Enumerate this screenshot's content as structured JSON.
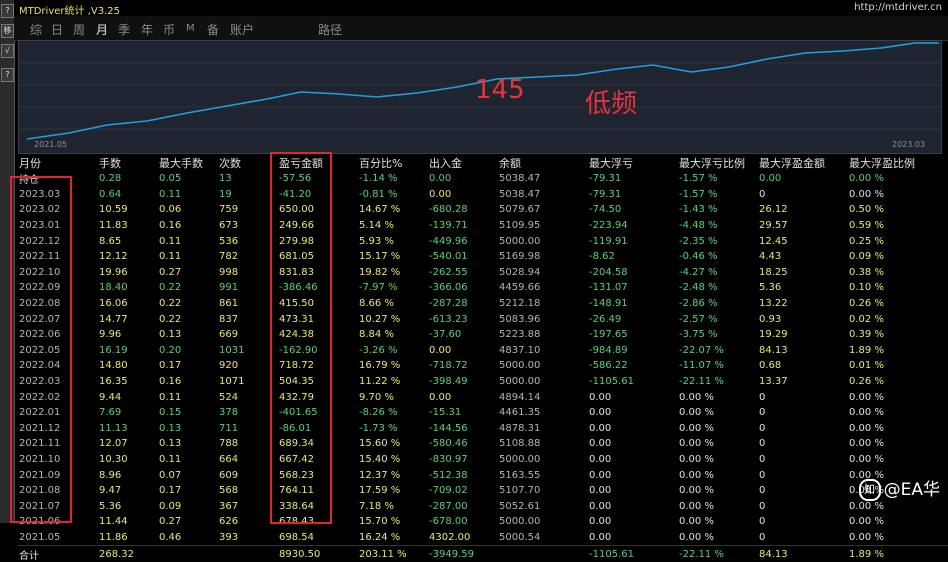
{
  "window": {
    "title": "MTDriver统计 ,V3.25",
    "url": "http://mtdriver.cn"
  },
  "left_buttons": [
    "?",
    "移",
    "√",
    "?"
  ],
  "tabs": [
    {
      "label": "综",
      "active": false
    },
    {
      "label": "日",
      "active": false
    },
    {
      "label": "周",
      "active": false
    },
    {
      "label": "月",
      "active": true
    },
    {
      "label": "季",
      "active": false
    },
    {
      "label": "年",
      "active": false
    },
    {
      "label": "币",
      "active": false
    },
    {
      "label": "M",
      "active": false
    },
    {
      "label": "备",
      "active": false
    },
    {
      "label": "账户",
      "active": false
    },
    {
      "label": "路径",
      "active": false
    }
  ],
  "chart": {
    "start_date": "2021.05",
    "end_date": "2023.03",
    "line_color": "#1f9fe0",
    "overlay_number": "145",
    "overlay_text": "低频"
  },
  "table": {
    "headers": [
      "月份",
      "手数",
      "最大手数",
      "次数",
      "盈亏金额",
      "百分比%",
      "出入金",
      "余额",
      "最大浮亏",
      "最大浮亏比例",
      "最大浮盈金额",
      "最大浮盈比例"
    ],
    "rows": [
      [
        "持仓",
        "0.28",
        "0.05",
        "13",
        "-57.56",
        "-1.14 %",
        "0.00",
        "5038.47",
        "-79.31",
        "-1.57 %",
        "0.00",
        "0.00 %"
      ],
      [
        "2023.03",
        "0.64",
        "0.11",
        "19",
        "-41.20",
        "-0.81 %",
        "0.00",
        "5038.47",
        "-79.31",
        "-1.57 %",
        "0",
        "0.00 %"
      ],
      [
        "2023.02",
        "10.59",
        "0.06",
        "759",
        "650.00",
        "14.67 %",
        "-680.28",
        "5079.67",
        "-74.50",
        "-1.43 %",
        "26.12",
        "0.50 %"
      ],
      [
        "2023.01",
        "11.83",
        "0.16",
        "673",
        "249.66",
        "5.14 %",
        "-139.71",
        "5109.95",
        "-223.94",
        "-4.48 %",
        "29.57",
        "0.59 %"
      ],
      [
        "2022.12",
        "8.65",
        "0.11",
        "536",
        "279.98",
        "5.93 %",
        "-449.96",
        "5000.00",
        "-119.91",
        "-2.35 %",
        "12.45",
        "0.25 %"
      ],
      [
        "2022.11",
        "12.12",
        "0.11",
        "782",
        "681.05",
        "15.17 %",
        "-540.01",
        "5169.98",
        "-8.62",
        "-0.46 %",
        "4.43",
        "0.09 %"
      ],
      [
        "2022.10",
        "19.96",
        "0.27",
        "998",
        "831.83",
        "19.82 %",
        "-262.55",
        "5028.94",
        "-204.58",
        "-4.27 %",
        "18.25",
        "0.38 %"
      ],
      [
        "2022.09",
        "18.40",
        "0.22",
        "991",
        "-386.46",
        "-7.97 %",
        "-366.06",
        "4459.66",
        "-131.07",
        "-2.48 %",
        "5.36",
        "0.10 %"
      ],
      [
        "2022.08",
        "16.06",
        "0.22",
        "861",
        "415.50",
        "8.66 %",
        "-287.28",
        "5212.18",
        "-148.91",
        "-2.86 %",
        "13.22",
        "0.26 %"
      ],
      [
        "2022.07",
        "14.77",
        "0.22",
        "837",
        "473.31",
        "10.27 %",
        "-613.23",
        "5083.96",
        "-26.49",
        "-2.57 %",
        "0.93",
        "0.02 %"
      ],
      [
        "2022.06",
        "9.96",
        "0.13",
        "669",
        "424.38",
        "8.84 %",
        "-37.60",
        "5223.88",
        "-197.65",
        "-3.75 %",
        "19.29",
        "0.39 %"
      ],
      [
        "2022.05",
        "16.19",
        "0.20",
        "1031",
        "-162.90",
        "-3.26 %",
        "0.00",
        "4837.10",
        "-984.89",
        "-22.07 %",
        "84.13",
        "1.89 %"
      ],
      [
        "2022.04",
        "14.80",
        "0.17",
        "920",
        "718.72",
        "16.79 %",
        "-718.72",
        "5000.00",
        "-586.22",
        "-11.07 %",
        "0.68",
        "0.01 %"
      ],
      [
        "2022.03",
        "16.35",
        "0.16",
        "1071",
        "504.35",
        "11.22 %",
        "-398.49",
        "5000.00",
        "-1105.61",
        "-22.11 %",
        "13.37",
        "0.26 %"
      ],
      [
        "2022.02",
        "9.44",
        "0.11",
        "524",
        "432.79",
        "9.70 %",
        "0.00",
        "4894.14",
        "0.00",
        "0.00 %",
        "0",
        "0.00 %"
      ],
      [
        "2022.01",
        "7.69",
        "0.15",
        "378",
        "-401.65",
        "-8.26 %",
        "-15.31",
        "4461.35",
        "0.00",
        "0.00 %",
        "0",
        "0.00 %"
      ],
      [
        "2021.12",
        "11.13",
        "0.13",
        "711",
        "-86.01",
        "-1.73 %",
        "-144.56",
        "4878.31",
        "0.00",
        "0.00 %",
        "0",
        "0.00 %"
      ],
      [
        "2021.11",
        "12.07",
        "0.13",
        "788",
        "689.34",
        "15.60 %",
        "-580.46",
        "5108.88",
        "0.00",
        "0.00 %",
        "0",
        "0.00 %"
      ],
      [
        "2021.10",
        "10.30",
        "0.11",
        "664",
        "667.42",
        "15.40 %",
        "-830.97",
        "5000.00",
        "0.00",
        "0.00 %",
        "0",
        "0.00 %"
      ],
      [
        "2021.09",
        "8.96",
        "0.07",
        "609",
        "568.23",
        "12.37 %",
        "-512.38",
        "5163.55",
        "0.00",
        "0.00 %",
        "0",
        "0.00 %"
      ],
      [
        "2021.08",
        "9.47",
        "0.17",
        "568",
        "764.11",
        "17.59 %",
        "-709.02",
        "5107.70",
        "0.00",
        "0.00 %",
        "0",
        "0.00 %"
      ],
      [
        "2021.07",
        "5.36",
        "0.09",
        "367",
        "338.64",
        "7.18 %",
        "-287.00",
        "5052.61",
        "0.00",
        "0.00 %",
        "0",
        "0.00 %"
      ],
      [
        "2021.06",
        "11.44",
        "0.27",
        "626",
        "678.43",
        "15.70 %",
        "-678.00",
        "5000.00",
        "0.00",
        "0.00 %",
        "0",
        "0.00 %"
      ],
      [
        "2021.05",
        "11.86",
        "0.46",
        "393",
        "698.54",
        "16.24 %",
        "4302.00",
        "5000.54",
        "0.00",
        "0.00 %",
        "0",
        "0.00 %"
      ]
    ],
    "total": [
      "合计",
      "268.32",
      "",
      "",
      "8930.50",
      "203.11 %",
      "-3949.59",
      "",
      "-1105.61",
      "-22.11 %",
      "84.13",
      "1.89 %"
    ]
  },
  "watermark": {
    "icon": "zhihu-icon",
    "text": "@EA华"
  }
}
